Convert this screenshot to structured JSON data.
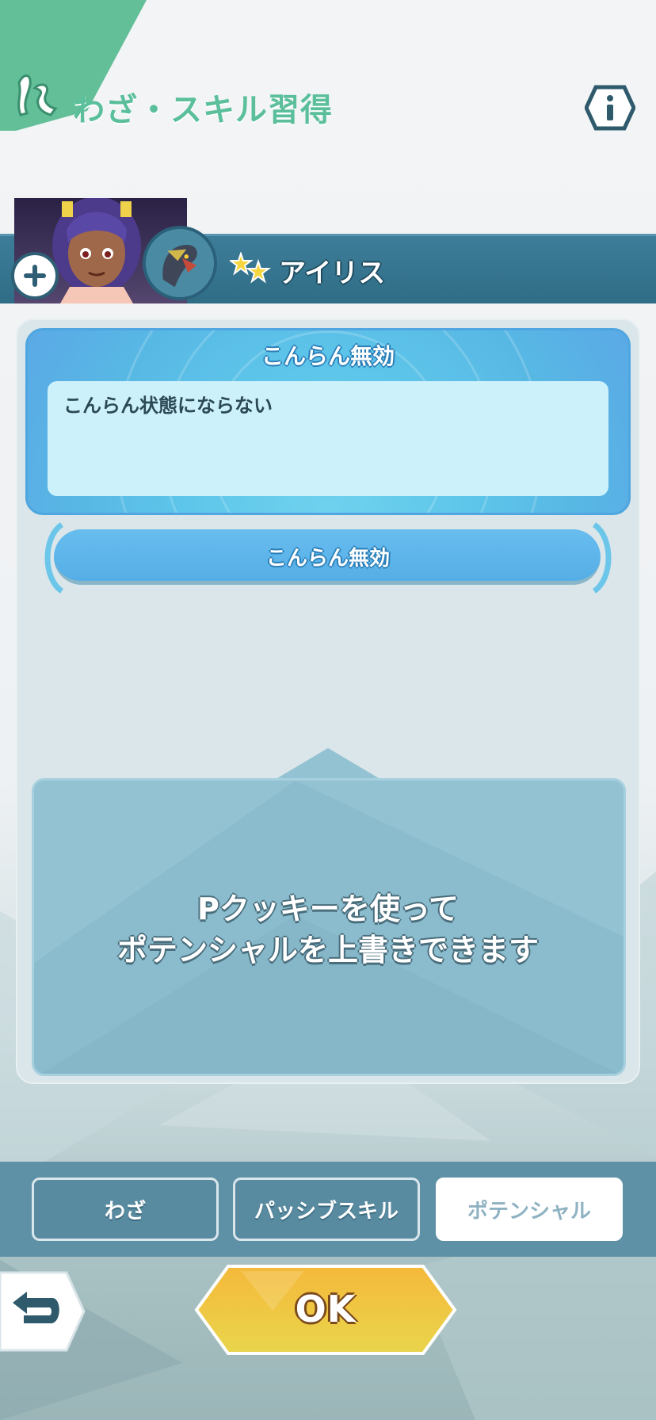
{
  "header": {
    "title": "わざ・スキル習得",
    "info_icon": "info-icon",
    "title_icon": "feather-icon"
  },
  "character": {
    "name": "アイリス",
    "rarity_stars": 2,
    "add_icon": "plus-icon"
  },
  "skill": {
    "title": "こんらん無効",
    "description": "こんらん状態にならない"
  },
  "potential": {
    "current_label": "こんらん無効"
  },
  "message": {
    "line1": "Pクッキーを使って",
    "line2": "ポテンシャルを上書きできます"
  },
  "tabs": [
    {
      "label": "わざ",
      "active": false
    },
    {
      "label": "パッシブスキル",
      "active": false
    },
    {
      "label": "ポテンシャル",
      "active": true
    }
  ],
  "footer": {
    "ok_label": "OK",
    "back_icon": "back-arrow-icon"
  },
  "colors": {
    "accent_green": "#5abf9a",
    "bar_teal": "#2f6d86",
    "skill_blue": "#5ec6ea",
    "ok_yellow": "#f0c23a"
  }
}
